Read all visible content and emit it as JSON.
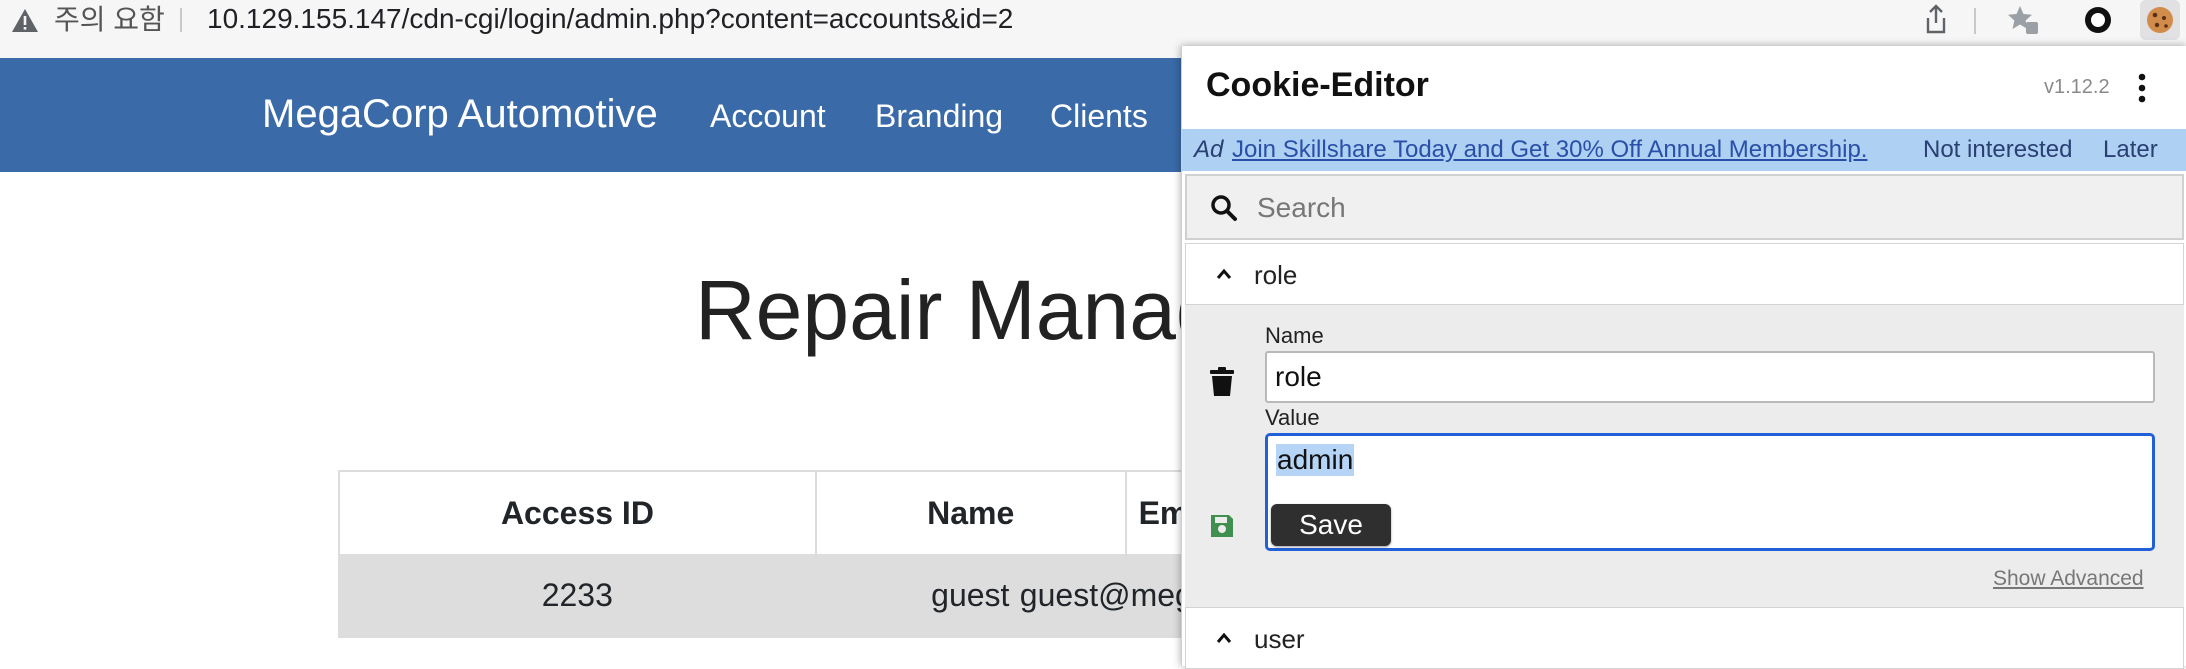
{
  "browser": {
    "security_warning": "주의 요함",
    "url": "10.129.155.147/cdn-cgi/login/admin.php?content=accounts&id=2",
    "toolbar_icons": [
      "share-icon",
      "bookmark-star-icon",
      "circle-extension-icon",
      "cookie-extension-icon"
    ]
  },
  "navbar": {
    "brand": "MegaCorp Automotive",
    "links": [
      "Account",
      "Branding",
      "Clients"
    ]
  },
  "page": {
    "title": "Repair Management System",
    "table": {
      "headers": [
        "Access ID",
        "Name",
        "Email"
      ],
      "rows": [
        [
          "2233",
          "guest",
          "guest@megacorp.com"
        ]
      ]
    }
  },
  "cookie_editor": {
    "title": "Cookie-Editor",
    "version": "v1.12.2",
    "ad": {
      "tag": "Ad",
      "link_text": "Join Skillshare Today and Get 30% Off Annual Membership.",
      "not_interested": "Not interested",
      "later": "Later"
    },
    "search_placeholder": "Search",
    "cookies": [
      {
        "name": "role",
        "expanded": true,
        "name_label": "Name",
        "name_value": "role",
        "value_label": "Value",
        "value": "admin",
        "save_label": "Save",
        "show_advanced": "Show Advanced"
      },
      {
        "name": "user",
        "expanded": false
      }
    ],
    "colors": {
      "accent": "#2160d6",
      "ad_background": "#aed0f2",
      "save_icon": "#3f8f4f"
    }
  }
}
